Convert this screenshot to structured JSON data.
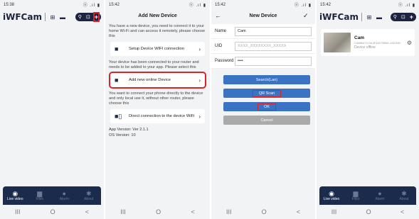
{
  "panel1": {
    "status": {
      "time": "15:38",
      "right": "ⓝ .ıl ▮"
    },
    "brand": "iWFCam",
    "tabs": [
      {
        "label": "Live video"
      },
      {
        "label": "Files"
      },
      {
        "label": "Alarm"
      },
      {
        "label": "About"
      }
    ]
  },
  "panel2": {
    "status": {
      "time": "15:42",
      "right": "ⓝ .ıl ▮"
    },
    "title": "Add New Device",
    "intro": "You have a new device, you need to connect it to your home Wi-Fi and can access it remotely, please choose this",
    "setup_label": "Setup Device WIFI connection",
    "connected_desc": "Your device has been connected to your router and needs to be added to your app. Please select this",
    "add_online_label": "Add new online Device",
    "direct_desc": "You want to connect your phone directly to the device and only local use it, without other router, please choose this",
    "direct_label": "Direct connection to the device WiFi",
    "app_version": "App Version: Ver 2.1.1",
    "os_version": "OS Version: 10"
  },
  "panel3": {
    "status": {
      "time": "15:42",
      "right": "ⓝ .ıl ▮"
    },
    "title": "New Device",
    "fields": [
      {
        "label": "Name",
        "value": "Cam"
      },
      {
        "label": "UID",
        "placeholder": "XXXX_XXXXXXXX_XXXXX"
      },
      {
        "label": "Password",
        "value": "••••"
      }
    ],
    "btn_search": "Search(Lan)",
    "btn_qr": "QR Scan",
    "btn_ok": "OK",
    "btn_cancel": "Cancel"
  },
  "panel4": {
    "status": {
      "time": "15:42",
      "right": "ⓝ .ıl ▮"
    },
    "brand": "iWFCam",
    "device": {
      "name": "Cam",
      "uid": "CAMBA73-DA3F46273B06-1A8 B9C",
      "status": "Device offline"
    },
    "tabs": [
      {
        "label": "Live video"
      },
      {
        "label": "Files"
      },
      {
        "label": "Alarm"
      },
      {
        "label": "About"
      }
    ]
  },
  "sysnav": {
    "recent": "III",
    "home": "O",
    "back": "<"
  },
  "colors": {
    "navy": "#1b2b4b",
    "accent_red": "#d9232a",
    "button_blue": "#3a72c4"
  }
}
